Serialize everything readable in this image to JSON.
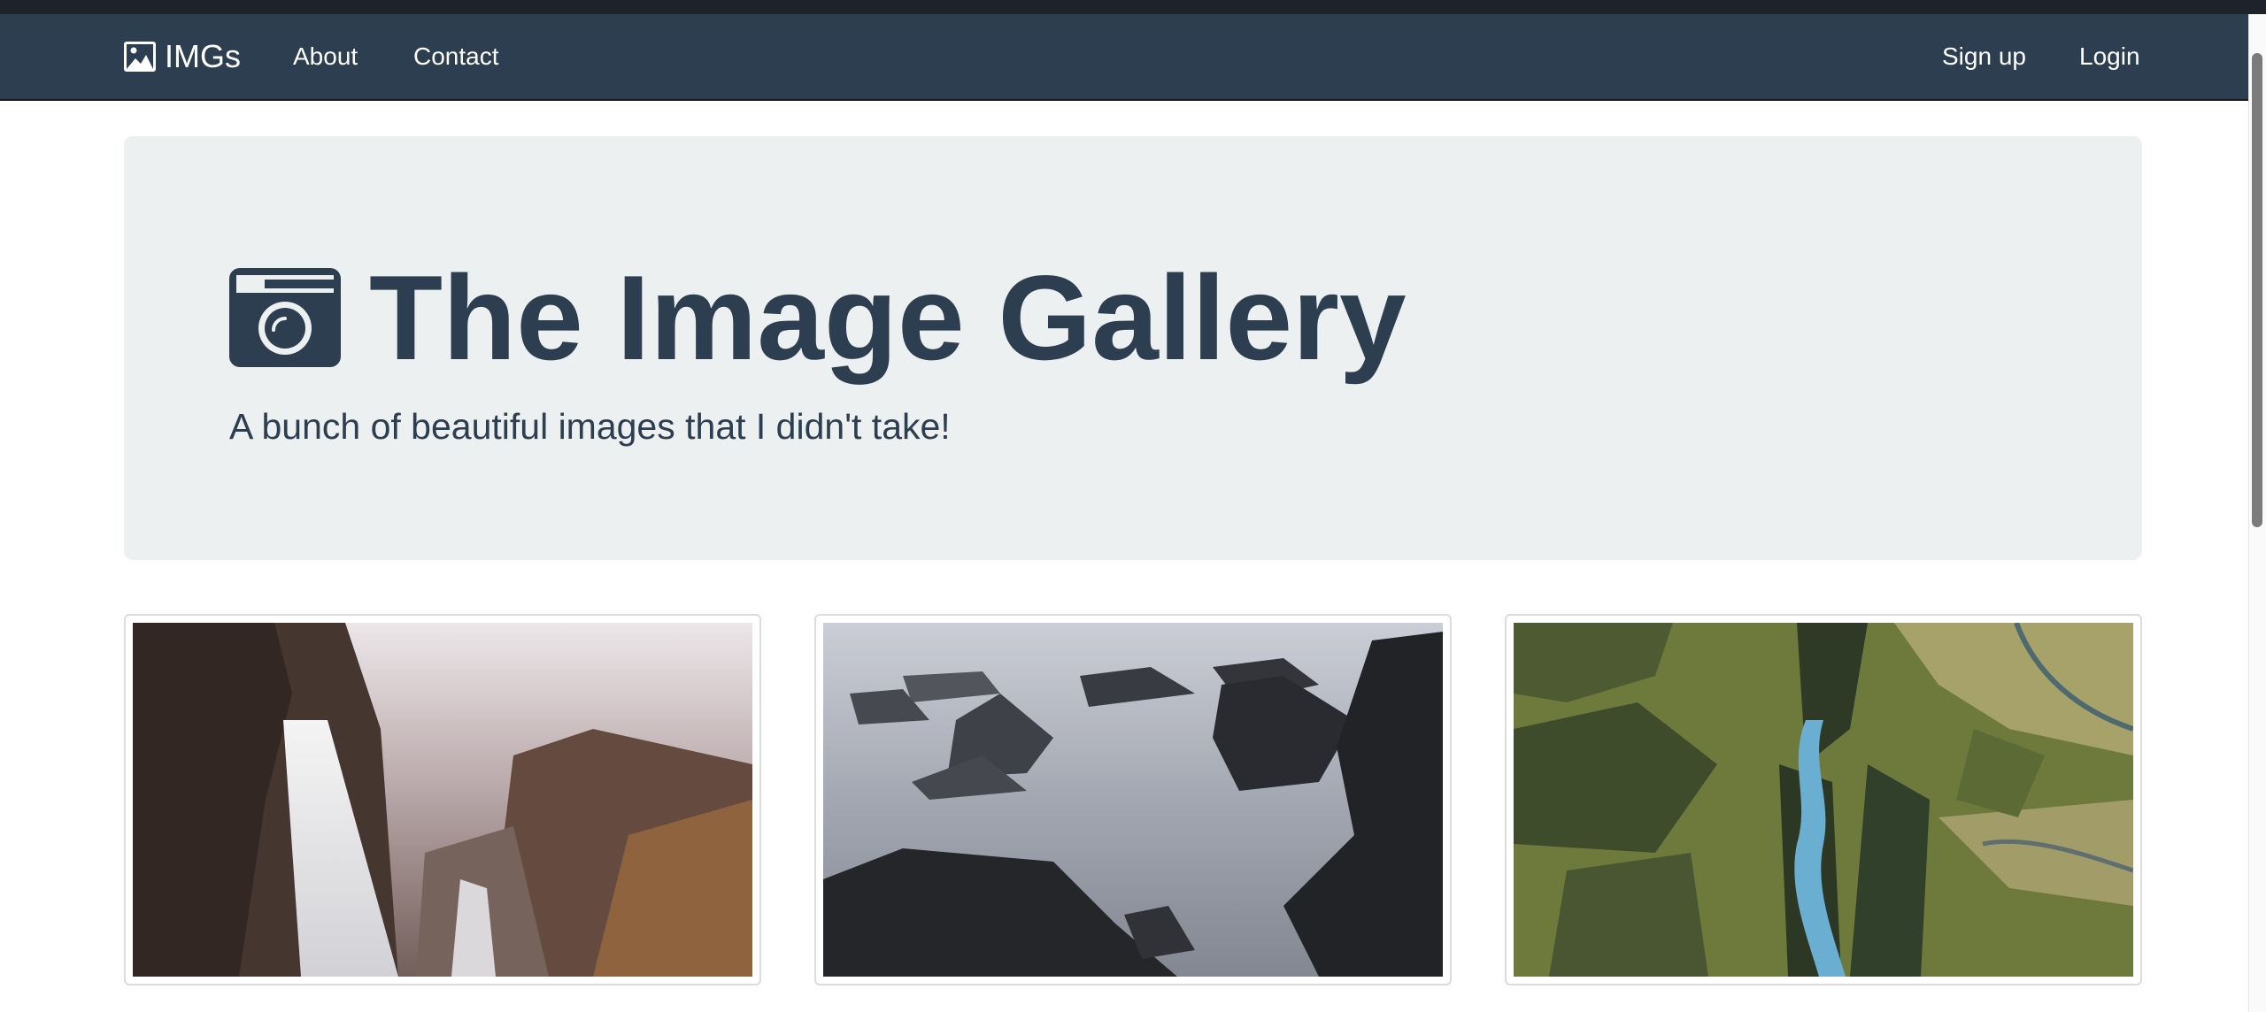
{
  "navbar": {
    "brand": {
      "icon": "image-icon",
      "label": "IMGs"
    },
    "left_links": [
      {
        "label": "About"
      },
      {
        "label": "Contact"
      }
    ],
    "right_links": [
      {
        "label": "Sign up"
      },
      {
        "label": "Login"
      }
    ]
  },
  "jumbotron": {
    "icon": "camera-icon",
    "title": "The Image Gallery",
    "subtitle": "A bunch of beautiful images that I didn't take!"
  },
  "gallery": {
    "images": [
      {
        "icon": "waterfall-photo"
      },
      {
        "icon": "misty-rocks-photo"
      },
      {
        "icon": "river-canyon-photo"
      }
    ]
  },
  "colors": {
    "navbar_bg": "#2c3e50",
    "top_strip": "#1e222b",
    "jumbotron_bg": "#ecf0f1",
    "text_primary": "#2c3e50",
    "nav_text": "#ffffff"
  }
}
